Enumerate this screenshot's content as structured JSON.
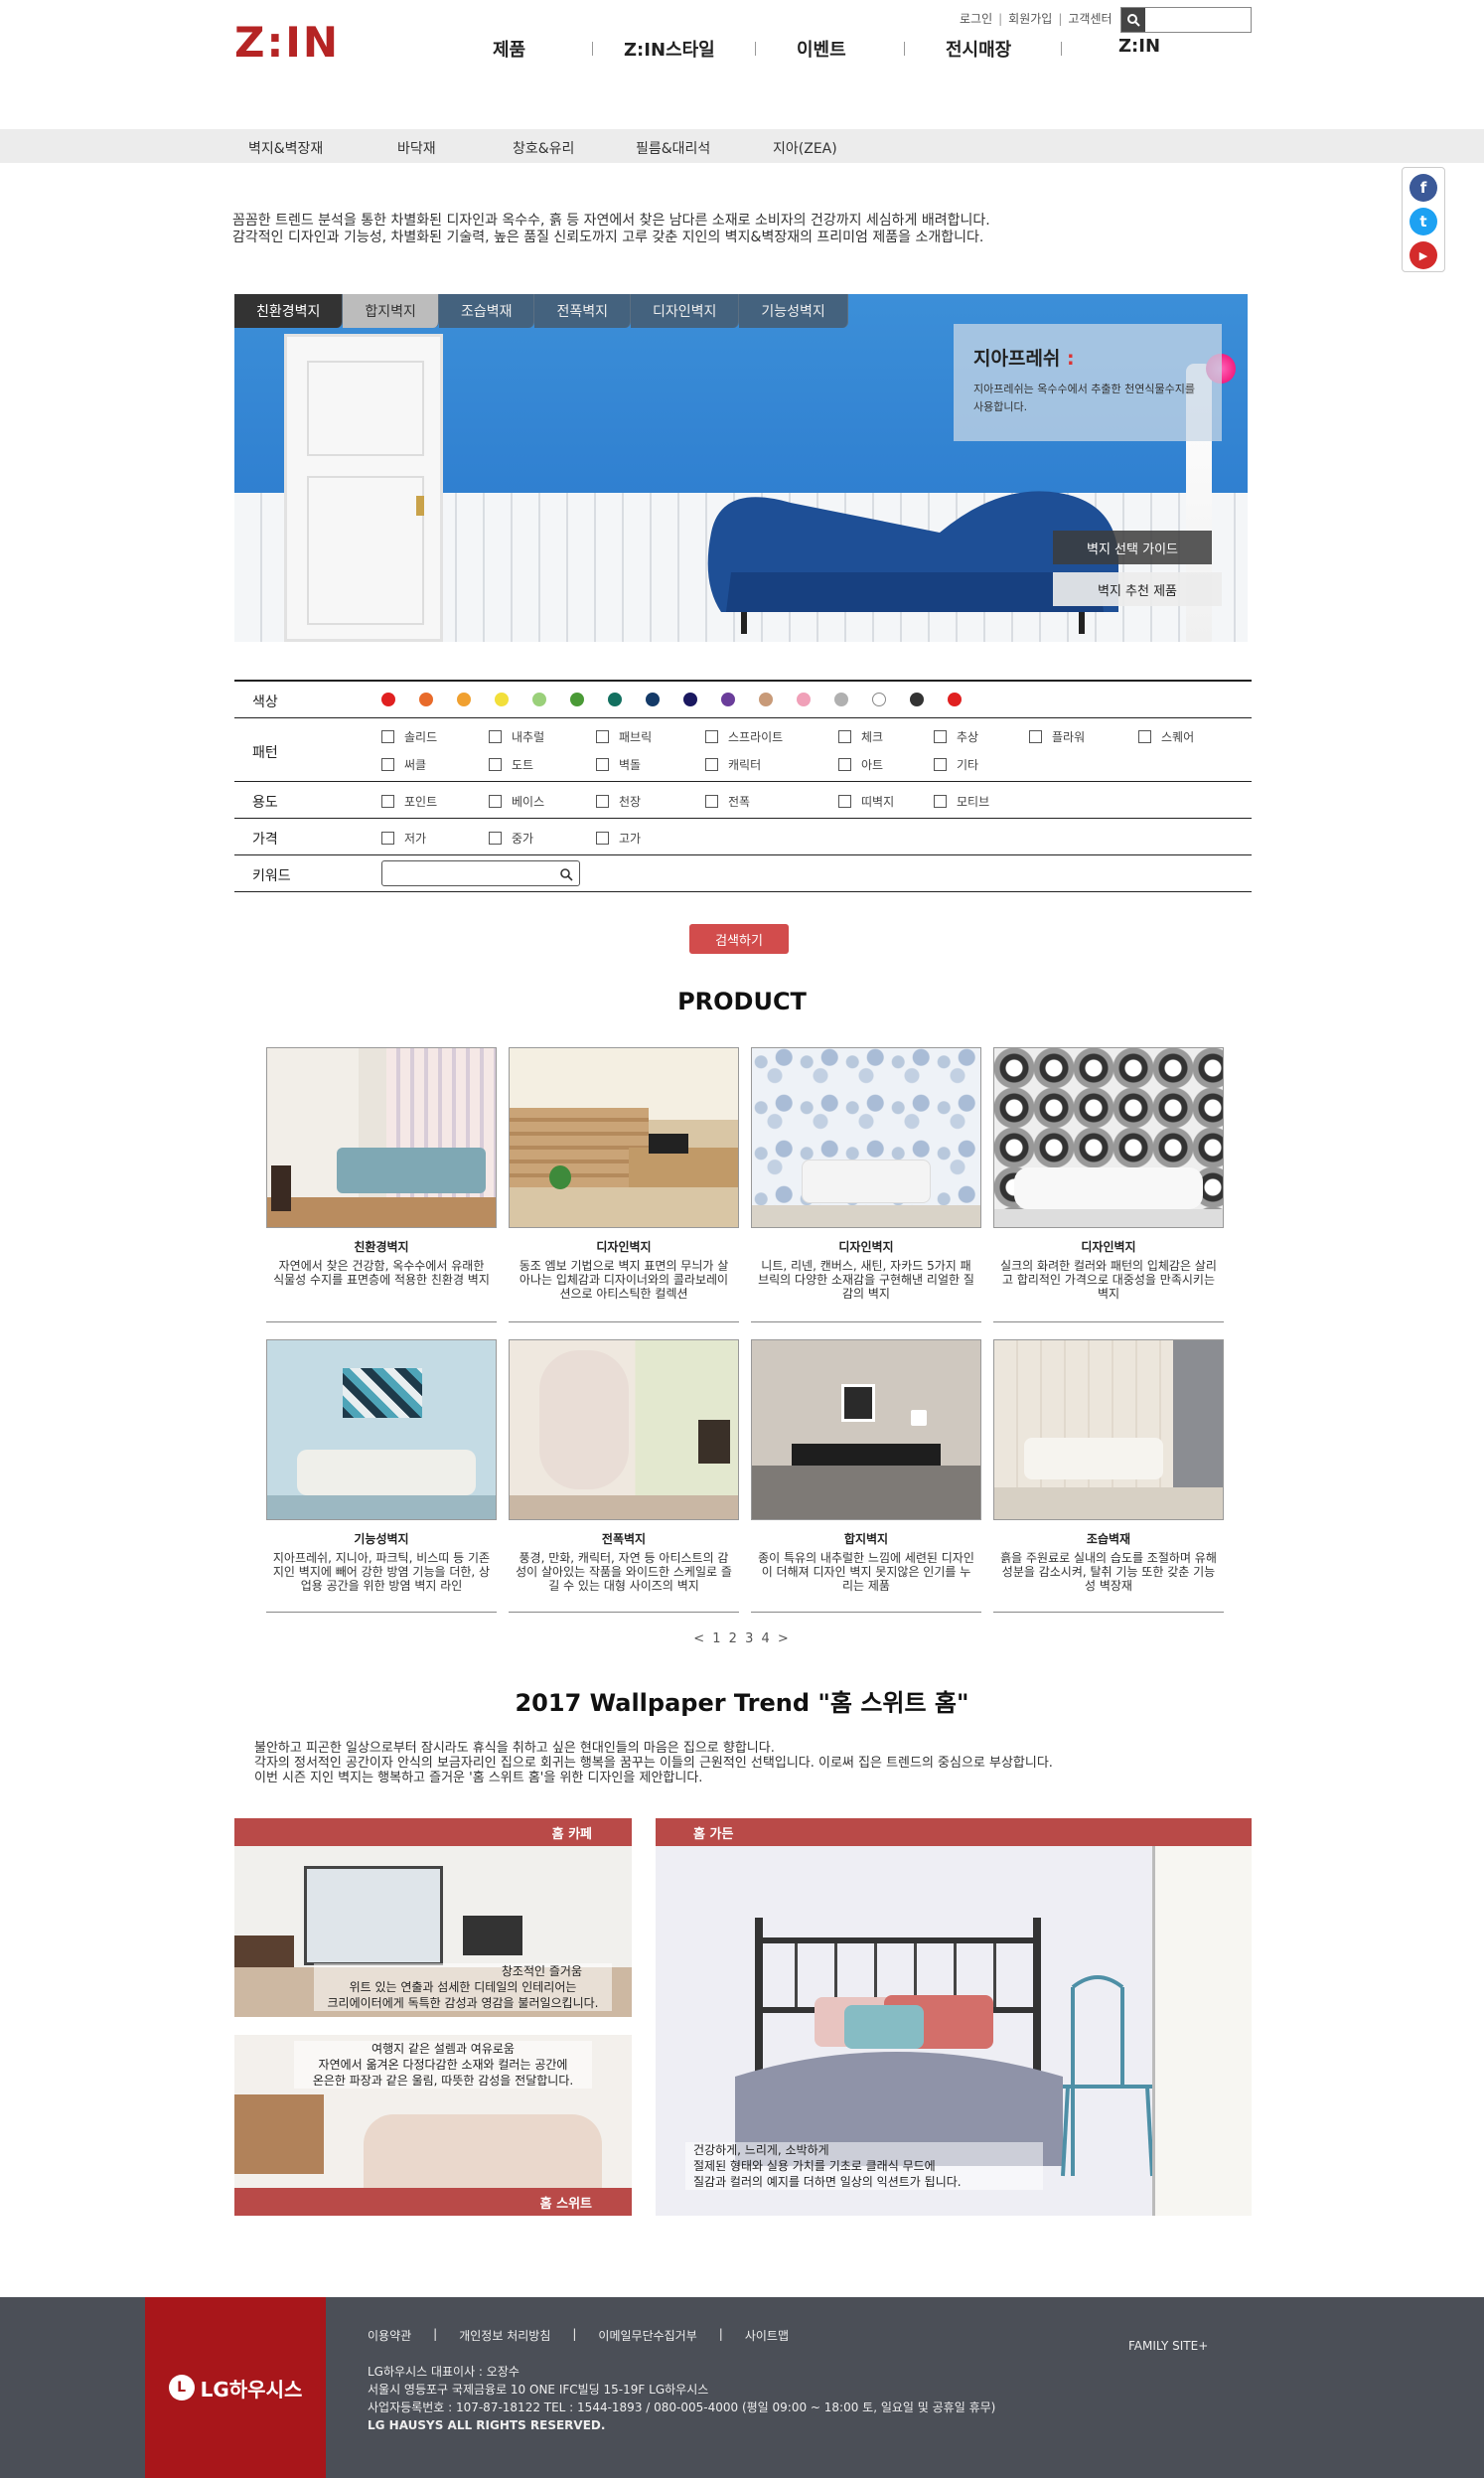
{
  "header": {
    "logo": "Z:IN",
    "util": {
      "login": "로그인",
      "join": "회원가입",
      "cs": "고객센터"
    },
    "nav": [
      "제품",
      "Z:IN스타일",
      "이벤트",
      "전시매장",
      "Z:IN"
    ]
  },
  "subnav": [
    "벽지&벽장재",
    "바닥재",
    "창호&유리",
    "필름&대리석",
    "지아(ZEA)"
  ],
  "sns": {
    "facebook": "f",
    "twitter": "t",
    "youtube": "▶"
  },
  "intro": [
    "꼼꼼한 트렌드 분석을 통한 차별화된 디자인과 옥수수, 흙 등 자연에서 찾은 남다른 소재로 소비자의 건강까지 세심하게 배려합니다.",
    "감각적인 디자인과 기능성, 차별화된 기술력, 높은 품질 신뢰도까지 고루 갖춘 지인의 벽지&벽장재의 프리미엄 제품을 소개합니다."
  ],
  "banner": {
    "tabs": [
      "친환경벽지",
      "합지벽지",
      "조습벽재",
      "전폭벽지",
      "디자인벽지",
      "기능성벽지"
    ],
    "info_title": "지아프레쉬",
    "info_desc": "지아프레쉬는 옥수수에서 추출한 천연식물수지를 사용합니다.",
    "guide_btn": "벽지 선택 가이드",
    "recommend_btn": "벽지 추천 제품"
  },
  "filter": {
    "color_label": "색상",
    "colors": [
      "#e02020",
      "#e86a2a",
      "#f0a030",
      "#f2df3a",
      "#9ad07a",
      "#4a9a36",
      "#137060",
      "#143a68",
      "#1a1860",
      "#6a3d9a",
      "#c89a78",
      "#f0a0b8",
      "#b0b0b0",
      "#ffffff",
      "#333333",
      "#e02020"
    ],
    "pattern_label": "패턴",
    "patterns_row1": [
      "솔리드",
      "내추럴",
      "패브릭",
      "스프라이트",
      "체크",
      "추상",
      "플라워",
      "스퀘어"
    ],
    "patterns_row2": [
      "써클",
      "도트",
      "벽돌",
      "캐릭터",
      "아트",
      "기타"
    ],
    "use_label": "용도",
    "uses": [
      "포인트",
      "베이스",
      "천장",
      "전폭",
      "띠벽지",
      "모티브"
    ],
    "price_label": "가격",
    "prices": [
      "저가",
      "중가",
      "고가"
    ],
    "keyword_label": "키워드",
    "keyword_value": ""
  },
  "search_btn": "검색하기",
  "product_title": "PRODUCT",
  "products": [
    {
      "name": "친환경벽지",
      "desc": "자연에서 찾은 건강함, 옥수수에서 유래한 식물성 수지를 표면층에 적용한 친환경 벽지"
    },
    {
      "name": "디자인벽지",
      "desc": "동조 엠보 기법으로 벽지 표면의 무늬가 살아나는 입체감과 디자이너와의 콜라보레이션으로 아티스틱한 컬렉션"
    },
    {
      "name": "디자인벽지",
      "desc": "니트, 리넨, 캔버스, 새틴, 자카드 5가지 패브릭의 다양한 소재감을 구현해낸 리얼한 질감의 벽지"
    },
    {
      "name": "디자인벽지",
      "desc": "실크의 화려한 컬러와 패턴의 입체감은 살리고 합리적인 가격으로 대중성을 만족시키는 벽지"
    },
    {
      "name": "기능성벽지",
      "desc": "지아프레쉬, 지니아, 파크틱, 비스띠 등 기존 지인 벽지에 빼어 강한 방염 기능을 더한, 상업용 공간을 위한 방염 벽지 라인"
    },
    {
      "name": "전폭벽지",
      "desc": "풍경, 만화, 캐릭터, 자연 등 아티스트의 감성이 살아있는 작품을 와이드한 스케일로 즐길 수 있는 대형 사이즈의 벽지"
    },
    {
      "name": "합지벽지",
      "desc": "종이 특유의 내추럴한 느낌에 세련된 디자인이 더해져 디자인 벽지 못지않은 인기를 누리는 제품"
    },
    {
      "name": "조습벽재",
      "desc": "흙을 주원료로 실내의 습도를 조절하며 유해성분을 감소시켜, 탈취 기능 또한 갖춘 기능성 벽장재"
    }
  ],
  "pager": "< 1 2 3 4 >",
  "trend": {
    "title": "2017 Wallpaper Trend \"홈 스위트 홈\"",
    "desc": [
      "불안하고 피곤한 일상으로부터 잠시라도 휴식을 취하고 싶은 현대인들의 마음은 집으로 향합니다.",
      "각자의 정서적인 공간이자 안식의 보금자리인 집으로 회귀는 행복을 꿈꾸는 이들의 근원적인 선택입니다. 이로써 집은 트렌드의 중심으로 부상합니다.",
      "이번 시즌 지인 벽지는 행복하고 즐거운 '홈 스위트 홈'을 위한 디자인을 제안합니다."
    ],
    "cafe": {
      "label": "홈 카페",
      "caption": [
        "위트 있는 연출과 섬세한 디테일의 인테리어는",
        "크리에이터에게 독특한 감성과 영감을 불러일으킵니다."
      ],
      "caption_top": "창조적인 즐거움"
    },
    "suite": {
      "label": "홈 스위트",
      "caption": [
        "여행지 같은 설렘과 여유로움",
        "자연에서 옮겨온 다정다감한 소재와 컬러는 공간에",
        "온은한 파장과 같은 울림, 따뜻한 감성을 전달합니다."
      ]
    },
    "garden": {
      "label": "홈 가든",
      "caption": [
        "건강하게, 느리게, 소박하게",
        "절제된 형태와 실용 가치를 기초로 클래식 무드에",
        "질감과 컬러의 예지를 더하면 일상의 익션트가 됩니다."
      ]
    }
  },
  "footer": {
    "logo": "LG하우시스",
    "links": [
      "이용약관",
      "개인정보 처리방침",
      "이메일무단수집거부",
      "사이트맵"
    ],
    "info": [
      "LG하우시스 대표이사 : 오장수",
      "서울시 영등포구 국제금융로 10 ONE IFC빌딩 15-19F LG하우시스",
      "사업자등록번호 : 107-87-18122 TEL : 1544-1893 / 080-005-4000 (평일 09:00 ~ 18:00 토, 일요일 및 공휴일 휴무)",
      "LG HAUSYS ALL RIGHTS RESERVED."
    ],
    "family": "FAMILY SITE+"
  }
}
